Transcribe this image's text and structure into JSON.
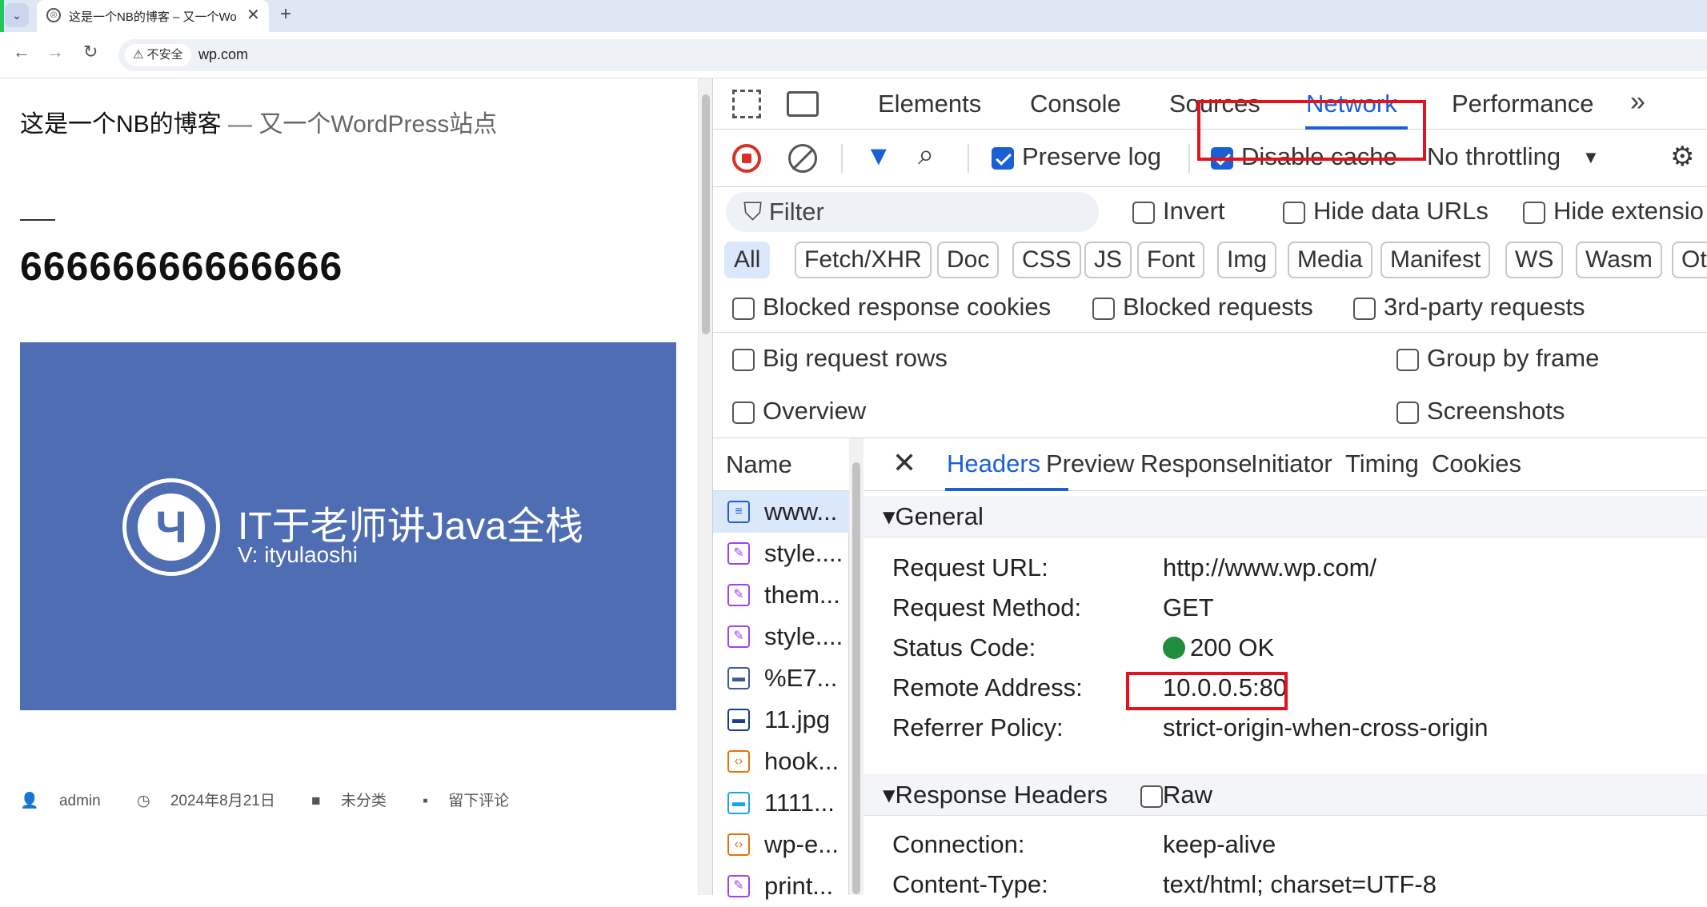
{
  "browser": {
    "tab_title": "这是一个NB的博客 – 又一个WordPress站点",
    "tab_menu_glyph": "⌄",
    "close_glyph": "✕",
    "new_tab_glyph": "+",
    "insecure_label": "⚠ 不安全",
    "url": "wp.com",
    "back_glyph": "←",
    "forward_glyph": "→",
    "reload_glyph": "↻"
  },
  "page": {
    "site_title": "这是一个NB的博客",
    "separator": "—",
    "tagline": "又一个WordPress站点",
    "post_title": "66666666666666",
    "hero_logo_glyph": "Ч",
    "hero_title": "IT于老师讲Java全栈",
    "hero_sub": "V: ityulaoshi",
    "meta_author": "admin",
    "meta_date": "2024年8月21日",
    "meta_category": "未分类",
    "meta_comment": "留下评论",
    "meta_icons": {
      "author": "👤",
      "date": "◷",
      "category": "■",
      "comment": "▪"
    }
  },
  "devtools": {
    "tabs": [
      "Elements",
      "Console",
      "Sources",
      "Network",
      "Performance"
    ],
    "active_tab": "Network",
    "more_glyph": "»",
    "toolbar": {
      "preserve_log": "Preserve log",
      "disable_cache": "Disable cache",
      "throttling": "No throttling",
      "throttle_arrow": "▼",
      "filter_glyph": "▼",
      "search_glyph": "⌕",
      "wifi_glyph": "⚙"
    },
    "filter": {
      "placeholder": "Filter",
      "filter_icon_glyph": "⛉",
      "invert": "Invert",
      "hide_data_urls": "Hide data URLs",
      "hide_extensions": "Hide extensio"
    },
    "types": [
      "All",
      "Fetch/XHR",
      "Doc",
      "CSS",
      "JS",
      "Font",
      "Img",
      "Media",
      "Manifest",
      "WS",
      "Wasm",
      "Ot"
    ],
    "blocked": {
      "cookies": "Blocked response cookies",
      "requests": "Blocked requests",
      "third_party": "3rd-party requests"
    },
    "options": {
      "big_rows": "Big request rows",
      "group_by_frame": "Group by frame",
      "overview": "Overview",
      "screenshots": "Screenshots"
    },
    "name_header": "Name",
    "requests": [
      {
        "name": "www...",
        "icon": "≡",
        "color": "#1a5fd6"
      },
      {
        "name": "style....",
        "icon": "✎",
        "color": "#a142f4"
      },
      {
        "name": "them...",
        "icon": "✎",
        "color": "#a142f4"
      },
      {
        "name": "style....",
        "icon": "✎",
        "color": "#a142f4"
      },
      {
        "name": "%E7...",
        "icon": "▬",
        "color": "#3c5a9a"
      },
      {
        "name": "11.jpg",
        "icon": "▬",
        "color": "#1a3e8c"
      },
      {
        "name": "hook...",
        "icon": "‹›",
        "color": "#e8710a"
      },
      {
        "name": "1111...",
        "icon": "▬",
        "color": "#1aa3e8"
      },
      {
        "name": "wp-e...",
        "icon": "‹›",
        "color": "#e8710a"
      },
      {
        "name": "print...",
        "icon": "✎",
        "color": "#a142f4"
      }
    ],
    "detail_tabs": [
      "Headers",
      "Preview",
      "Response",
      "Initiator",
      "Timing",
      "Cookies"
    ],
    "detail_close_glyph": "✕",
    "general_label": "▾General",
    "general": [
      {
        "key": "Request URL:",
        "val": "http://www.wp.com/"
      },
      {
        "key": "Request Method:",
        "val": "GET"
      },
      {
        "key": "Status Code:",
        "val": "200 OK"
      },
      {
        "key": "Remote Address:",
        "val": "10.0.0.5:80"
      },
      {
        "key": "Referrer Policy:",
        "val": "strict-origin-when-cross-origin"
      }
    ],
    "response_headers_label": "▾Response Headers",
    "raw_label": "Raw",
    "response": [
      {
        "key": "Connection:",
        "val": "keep-alive"
      },
      {
        "key": "Content-Type:",
        "val": "text/html; charset=UTF-8"
      }
    ],
    "colors": {
      "accent": "#1a5fd6",
      "highlight_box": "#e5121d",
      "status_ok": "#1e8e3e"
    }
  }
}
